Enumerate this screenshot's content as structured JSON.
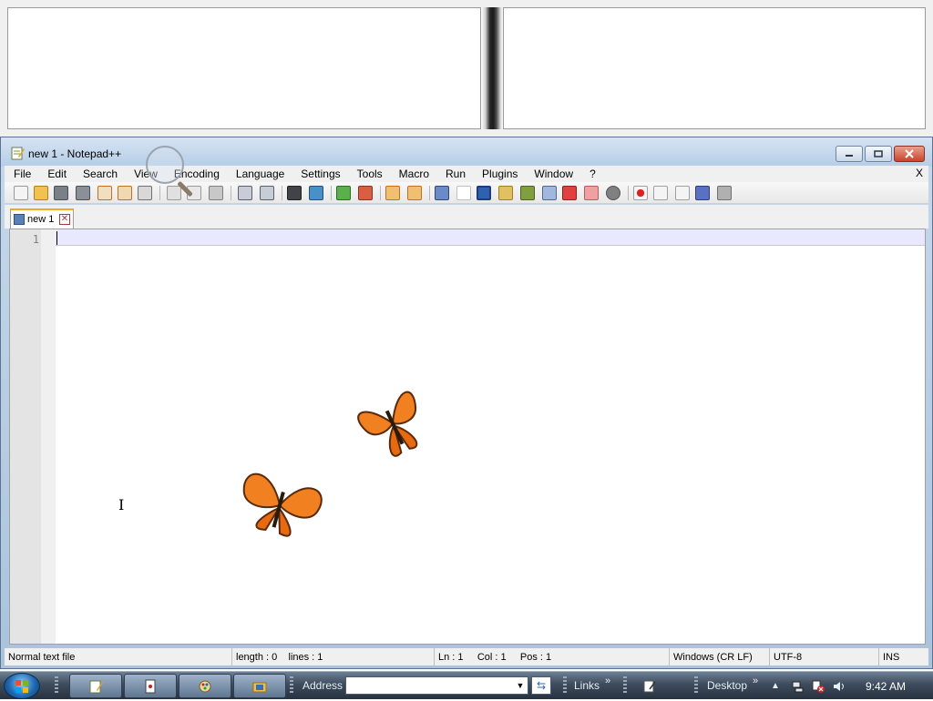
{
  "window": {
    "title": "new 1 - Notepad++",
    "close_x": "X"
  },
  "menu": [
    "File",
    "Edit",
    "Search",
    "View",
    "Encoding",
    "Language",
    "Settings",
    "Tools",
    "Macro",
    "Run",
    "Plugins",
    "Window",
    "?"
  ],
  "tab": {
    "label": "new 1"
  },
  "editor": {
    "line_number": "1"
  },
  "status": {
    "file_type": "Normal text file",
    "length": "length : 0",
    "lines": "lines : 1",
    "ln": "Ln : 1",
    "col": "Col : 1",
    "pos": "Pos : 1",
    "eol": "Windows (CR LF)",
    "encoding": "UTF-8",
    "mode": "INS"
  },
  "taskbar": {
    "address_label": "Address",
    "address_value": "",
    "links_label": "Links",
    "desktop_label": "Desktop",
    "chevron": "»",
    "clock": "9:42 AM"
  },
  "icons": {
    "toolbar": [
      "new-file-icon",
      "open-file-icon",
      "save-icon",
      "save-all-icon",
      "close-icon",
      "close-all-icon",
      "print-icon",
      "cut-icon",
      "copy-icon",
      "paste-icon",
      "undo-icon",
      "redo-icon",
      "find-icon",
      "replace-icon",
      "zoom-in-icon",
      "zoom-out-icon",
      "sync-vertical-icon",
      "sync-horizontal-icon",
      "word-wrap-icon",
      "show-all-chars-icon",
      "indent-guide-icon",
      "udl-icon",
      "doc-map-icon",
      "function-list-icon",
      "folder-as-workspace-icon",
      "monitoring-icon",
      "record-macro-icon",
      "stop-record-icon",
      "playback-icon",
      "run-macro-multiple-icon",
      "save-macro-icon"
    ]
  },
  "colors": {
    "accent": "#f5a623",
    "current_line": "#e8e8ff",
    "title_bar": "#b6cde6"
  }
}
